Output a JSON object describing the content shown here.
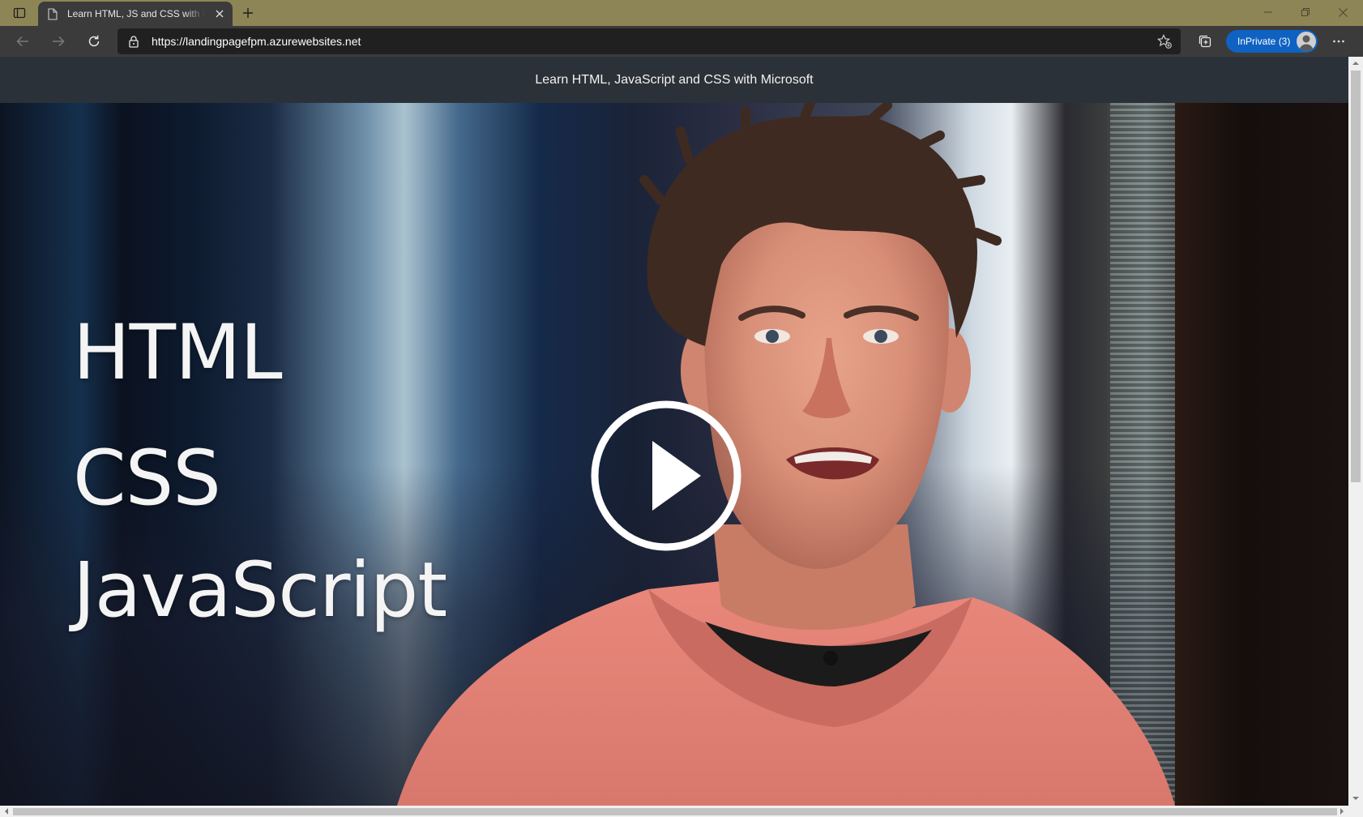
{
  "browser": {
    "tab": {
      "title": "Learn HTML, JS and CSS with Mi",
      "favicon": "page-icon",
      "close_icon": "close-icon"
    },
    "new_tab_icon": "plus-icon",
    "window_controls": [
      "minimize-icon",
      "restore-icon",
      "close-icon"
    ],
    "toolbar": {
      "back_icon": "back-arrow-icon",
      "forward_icon": "forward-arrow-icon",
      "refresh_icon": "refresh-icon",
      "lock_icon": "lock-icon",
      "url": "https://landingpagefpm.azurewebsites.net",
      "favorites_icon": "add-favorite-icon",
      "collections_icon": "collections-icon",
      "inprivate_label": "InPrivate (3)",
      "more_icon": "more-dots-icon"
    }
  },
  "page": {
    "header_title": "Learn HTML, JavaScript and CSS with Microsoft",
    "video": {
      "overlay_lines": [
        "HTML",
        "CSS",
        "JavaScript"
      ],
      "play_icon": "play-icon"
    }
  },
  "colors": {
    "tabstrip": "#8e8556",
    "toolbar": "#3b3b3b",
    "inprivate": "#0f62c2",
    "page_header": "#2b3138"
  }
}
